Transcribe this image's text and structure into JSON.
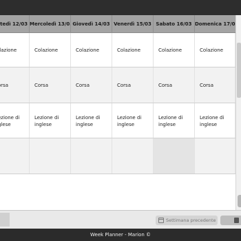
{
  "header": {
    "days": [
      "artedì 12/03",
      "Mercoledì 13/03",
      "Giovedì 14/03",
      "Venerdì 15/03",
      "Sabato 16/03",
      "Domenica 17/03"
    ]
  },
  "rows": [
    {
      "cells": [
        "olazione",
        "Colazione",
        "Colazione",
        "Colazione",
        "Colazione",
        "Colazione"
      ]
    },
    {
      "cells": [
        "orsa",
        "Corsa",
        "Corsa",
        "Corsa",
        "Corsa",
        "Corsa"
      ]
    },
    {
      "cells": [
        "ezione di\nglese",
        "Lezione di\ninglese",
        "Lezione di\ninglese",
        "Lezione di\ninglese",
        "Lezione di\ninglese",
        "Lezione di\ninglese"
      ]
    },
    {
      "cells": [
        "",
        "",
        "",
        "",
        "",
        ""
      ]
    }
  ],
  "footer": {
    "prev_label": "Settimana precedente",
    "prev_icon": "calendar-icon",
    "next_icon": "file-icon"
  },
  "status": {
    "text": "Week Planner - Marion ©"
  }
}
